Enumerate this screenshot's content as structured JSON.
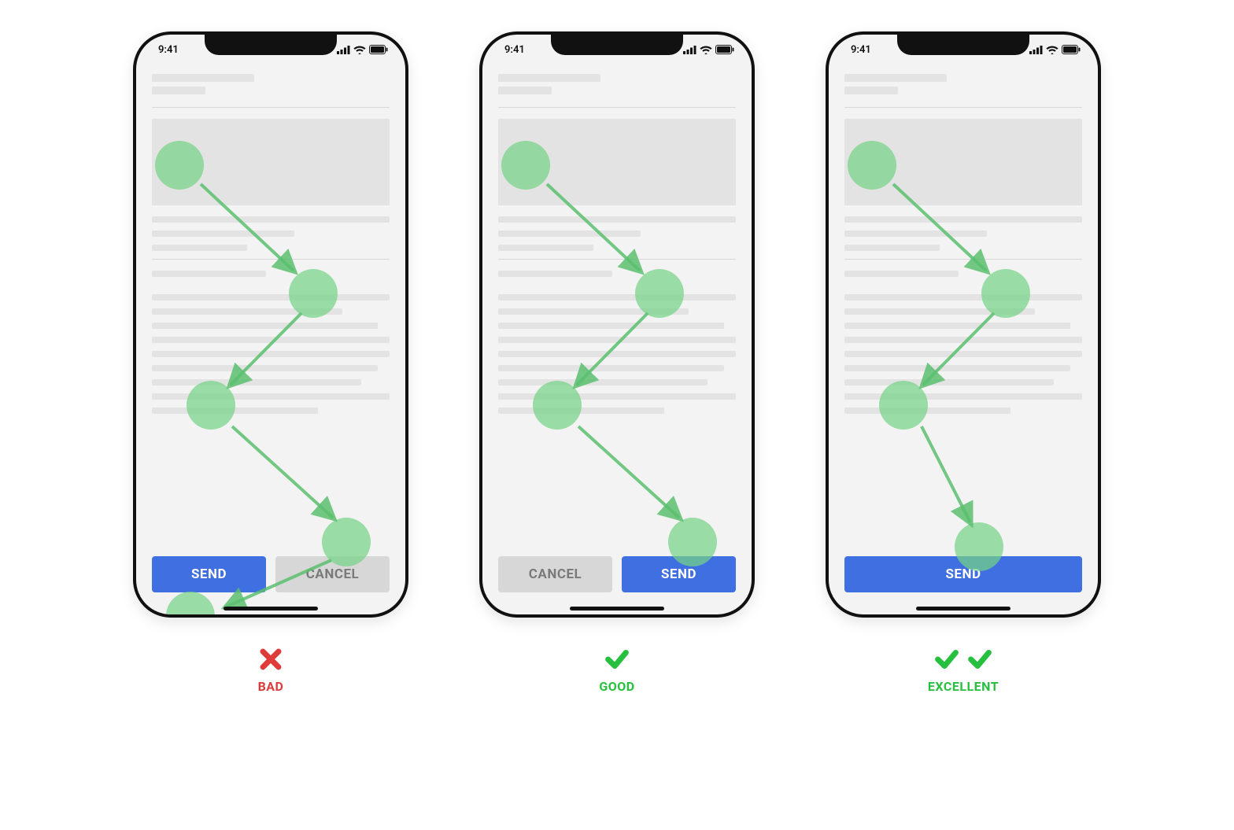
{
  "statusbar": {
    "time": "9:41"
  },
  "buttons": {
    "send": "SEND",
    "cancel": "CANCEL"
  },
  "verdicts": {
    "bad": "BAD",
    "good": "GOOD",
    "excellent": "EXCELLENT"
  },
  "colors": {
    "primary": "#3f6fe0",
    "good": "#26c03e",
    "bad": "#e03b3b",
    "gaze": "rgba(118,210,134,.72)"
  },
  "phones": [
    {
      "id": "bad",
      "layout": "send-left-cancel-right",
      "verdict": "bad",
      "marks": [
        "cross"
      ]
    },
    {
      "id": "good",
      "layout": "cancel-left-send-right",
      "verdict": "good",
      "marks": [
        "check"
      ]
    },
    {
      "id": "excellent",
      "layout": "send-full",
      "verdict": "excellent",
      "marks": [
        "check",
        "check"
      ]
    }
  ]
}
